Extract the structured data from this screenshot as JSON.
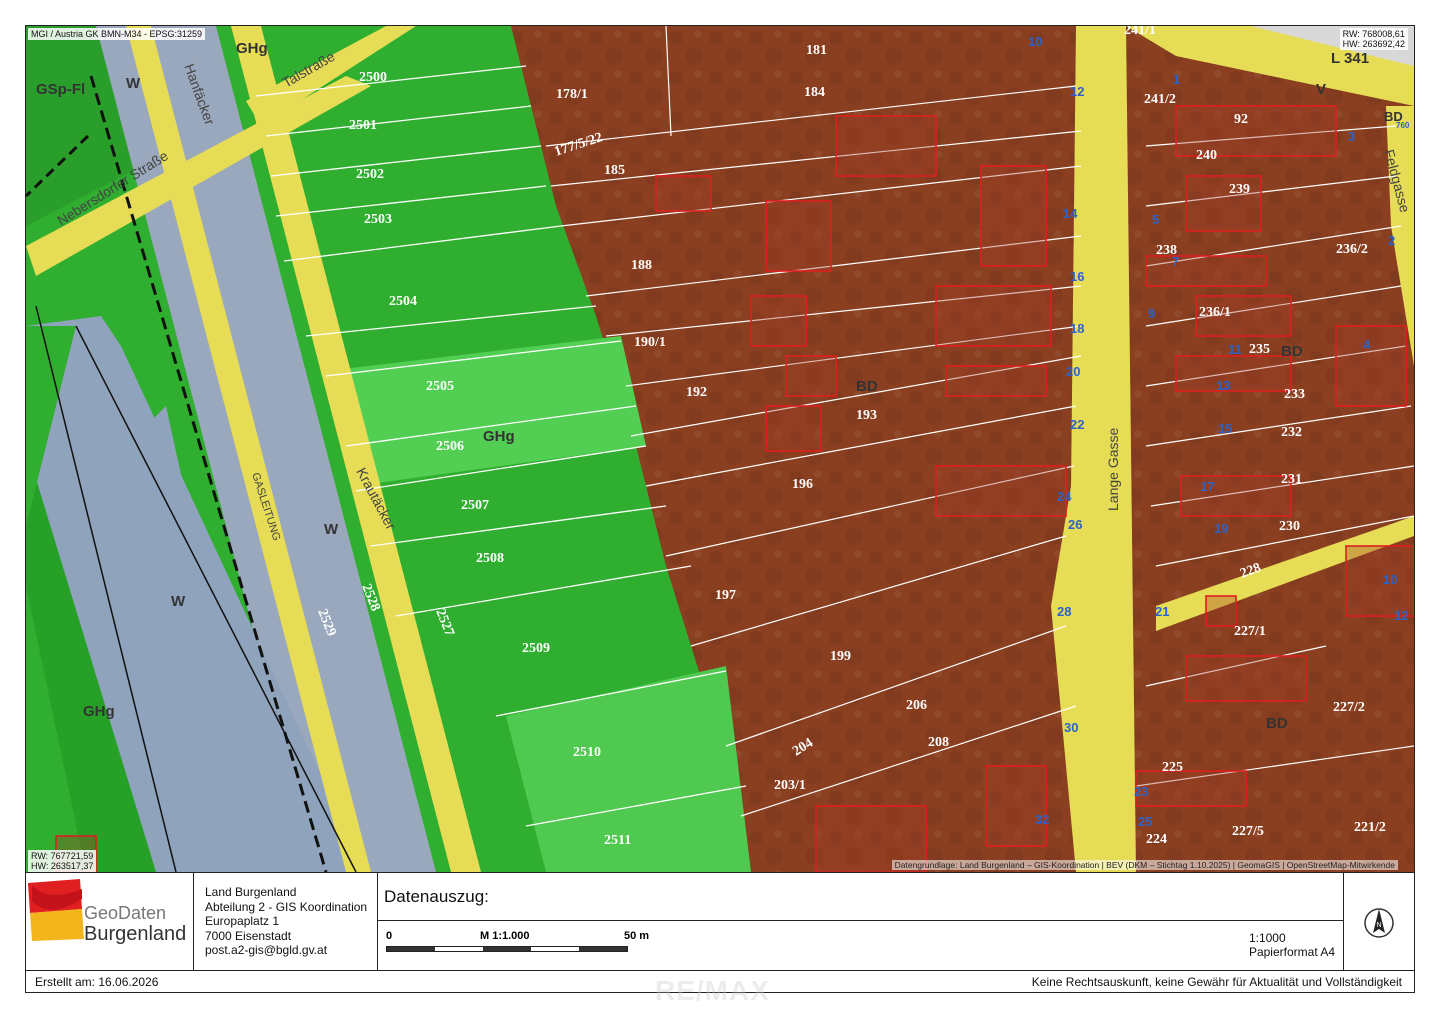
{
  "map": {
    "crs_label": "MGI / Austria GK BMN-M34 - EPSG:31259",
    "coord_top_right": {
      "rw": "RW: 768008,61",
      "hw": "HW: 263692,42"
    },
    "coord_bottom_left": {
      "rw": "RW: 767721,59",
      "hw": "HW: 263517,37"
    },
    "attribution": "Datengrundlage: Land Burgenland – GIS-Koordination | BEV (DKM – Stichtag 1.10.2025) | GeomaGIS | OpenStreetMap-Mitwirkende",
    "road_ref": "L 341",
    "streets": [
      "Talstraße",
      "Hanfäcker",
      "Nebersdorfer Straße",
      "Krautäcker",
      "GASLEITUNG",
      "Lange Gasse",
      "Feldgasse"
    ],
    "zones": [
      "GHg",
      "GSp-Fl",
      "W",
      "W",
      "W",
      "GHg",
      "GHg",
      "BD",
      "BD",
      "BD",
      "BD",
      "V"
    ],
    "parcels_green": [
      "2500",
      "2501",
      "2502",
      "2503",
      "2504",
      "2505",
      "2506",
      "2507",
      "2508",
      "2509",
      "2510",
      "2511",
      "2527",
      "2528",
      "2529"
    ],
    "parcels_brown": [
      "181",
      "178/1",
      "184",
      "177/5/22",
      "185",
      "188",
      "190/1",
      "192",
      "193",
      "196",
      "197",
      "199",
      "206",
      "208",
      "204",
      "203/1",
      "241/1",
      "241/2",
      "92",
      "240",
      "239",
      "238",
      "236/2",
      "236/1",
      "235",
      "233",
      "232",
      "231",
      "230",
      "228",
      "227/1",
      "227/2",
      "225",
      "224",
      "227/5",
      "221/2"
    ],
    "house_numbers": [
      "10",
      "12",
      "14",
      "16",
      "18",
      "20",
      "22",
      "24",
      "26",
      "28",
      "30",
      "32",
      "1",
      "3",
      "2",
      "4",
      "5",
      "7",
      "9",
      "11",
      "13",
      "15",
      "17",
      "19",
      "21",
      "23",
      "25",
      "10",
      "12",
      "760"
    ]
  },
  "colors": {
    "green_zone": "#2db52d",
    "light_green_zone": "#52d452",
    "brown_zone": "#8a3d1e",
    "road": "#e8e05a",
    "water": "#8fa6bf",
    "building_outline": "#e02020",
    "house_number": "#2b63c9"
  },
  "footer": {
    "logo_text_top": "GeoDaten",
    "logo_text_bottom": "Burgenland",
    "org_lines": [
      "Land Burgenland",
      "Abteilung 2 - GIS Koordination",
      "Europaplatz 1",
      "7000 Eisenstadt",
      "post.a2-gis@bgld.gv.at"
    ],
    "title": "Datenauszug:",
    "scalebar": {
      "start": "0",
      "middle": "M 1:1.000",
      "end": "50 m"
    },
    "scale_text": "1:1000",
    "paper_format": "Papierformat A4",
    "north_icon": "north-arrow-icon",
    "created": "Erstellt am: 16.06.2026",
    "disclaimer": "Keine Rechtsauskunft, keine Gewähr für Aktualität und Vollständigkeit"
  },
  "watermark": "RE/MAX"
}
